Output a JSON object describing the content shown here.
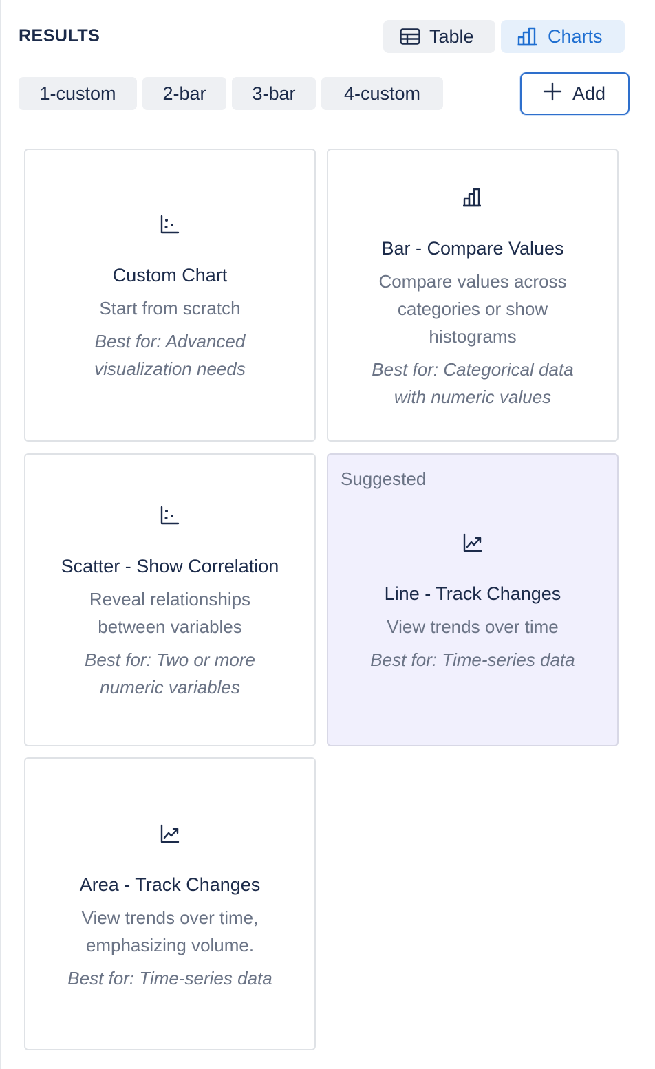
{
  "header": {
    "title": "RESULTS",
    "table_label": "Table",
    "charts_label": "Charts"
  },
  "tabs": [
    "1-custom",
    "2-bar",
    "3-bar",
    "4-custom"
  ],
  "add_label": "Add",
  "cards": [
    {
      "icon": "scatter-chart-icon",
      "title": "Custom Chart",
      "description": "Start from scratch",
      "best_for": "Best for: Advanced visualization needs"
    },
    {
      "icon": "bar-chart-icon",
      "title": "Bar - Compare Values",
      "description": "Compare values across categories or show histograms",
      "best_for": "Best for: Categorical data with numeric values"
    },
    {
      "icon": "scatter-chart-icon",
      "title": "Scatter - Show Correlation",
      "description": "Reveal relationships between variables",
      "best_for": "Best for: Two or more numeric variables"
    },
    {
      "icon": "line-chart-icon",
      "badge": "Suggested",
      "title": "Line - Track Changes",
      "description": "View trends over time",
      "best_for": "Best for: Time-series data"
    },
    {
      "icon": "area-chart-icon",
      "title": "Area - Track Changes",
      "description": "View trends over time, emphasizing volume.",
      "best_for": "Best for: Time-series data"
    }
  ],
  "colors": {
    "accent": "#1f6fd1",
    "suggested_bg": "#f1f0fd",
    "text_primary": "#1c2b4a",
    "text_secondary": "#6a7385"
  }
}
